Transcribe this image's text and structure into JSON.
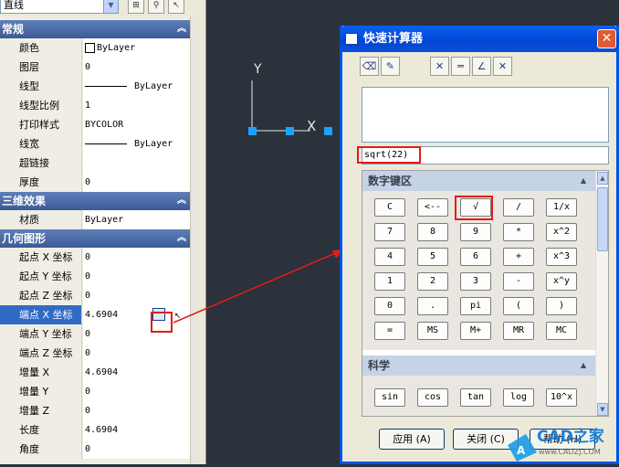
{
  "properties": {
    "object_type": "直线",
    "sections": [
      {
        "title": "常规",
        "rows": [
          {
            "label": "颜色",
            "value": "ByLayer",
            "swatch": "color"
          },
          {
            "label": "图层",
            "value": "0"
          },
          {
            "label": "线型",
            "value": "ByLayer",
            "swatch": "line"
          },
          {
            "label": "线型比例",
            "value": "1"
          },
          {
            "label": "打印样式",
            "value": "BYCOLOR"
          },
          {
            "label": "线宽",
            "value": "ByLayer",
            "swatch": "line"
          },
          {
            "label": "超链接",
            "value": ""
          },
          {
            "label": "厚度",
            "value": "0"
          }
        ]
      },
      {
        "title": "三维效果",
        "rows": [
          {
            "label": "材质",
            "value": "ByLayer"
          }
        ]
      },
      {
        "title": "几何图形",
        "rows": [
          {
            "label": "起点 X 坐标",
            "value": "0"
          },
          {
            "label": "起点 Y 坐标",
            "value": "0"
          },
          {
            "label": "起点 Z 坐标",
            "value": "0"
          },
          {
            "label": "端点 X 坐标",
            "value": "4.6904",
            "selected": true
          },
          {
            "label": "端点 Y 坐标",
            "value": "0"
          },
          {
            "label": "端点 Z 坐标",
            "value": "0"
          },
          {
            "label": "增量 X",
            "value": "4.6904"
          },
          {
            "label": "增量 Y",
            "value": "0"
          },
          {
            "label": "增量 Z",
            "value": "0"
          },
          {
            "label": "长度",
            "value": "4.6904"
          },
          {
            "label": "角度",
            "value": "0"
          }
        ]
      }
    ]
  },
  "canvas": {
    "ucs_y_label": "Y",
    "ucs_x_label": "X",
    "grip_color": "#1aa3ff",
    "axis_color": "#e6e6e6"
  },
  "calculator": {
    "title": "快速计算器",
    "close_glyph": "✕",
    "input_value": "sqrt(22)",
    "numpad_title": "数字键区",
    "numpad_keys": [
      "C",
      "<--",
      "√",
      "/",
      "1/x",
      "7",
      "8",
      "9",
      "*",
      "x^2",
      "4",
      "5",
      "6",
      "+",
      "x^3",
      "1",
      "2",
      "3",
      "-",
      "x^y",
      "0",
      ".",
      "pi",
      "(",
      ")",
      "=",
      "MS",
      "M+",
      "MR",
      "MC"
    ],
    "science_title": "科学",
    "science_keys": [
      "sin",
      "cos",
      "tan",
      "log",
      "10^x"
    ],
    "apply_label": "应用 (A)",
    "close_label": "关闭 (C)",
    "help_label": "帮助 (H)"
  },
  "watermark": {
    "brand": "CAD之家",
    "url": "www.CADZJ.COM"
  },
  "colors": {
    "highlight": "#e21c1c",
    "title_blue": "#0a58e8",
    "section_blue": "#4a6aa8"
  }
}
